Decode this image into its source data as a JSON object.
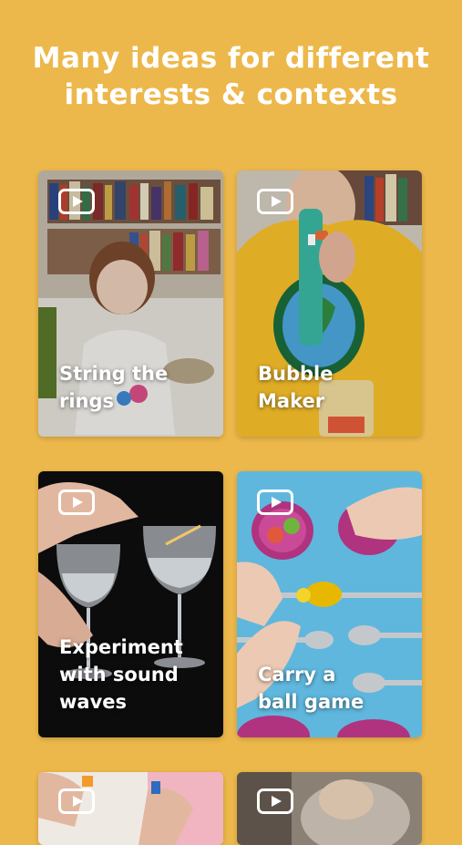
{
  "headline": "Many ideas for different\ninterests & contexts",
  "cards": [
    {
      "title": "String the\nrings",
      "icon": "play-video-icon"
    },
    {
      "title": "Bubble\nMaker",
      "icon": "play-video-icon"
    },
    {
      "title": "Experiment\nwith sound\nwaves",
      "icon": "play-video-icon"
    },
    {
      "title": "Carry a\nball game",
      "icon": "play-video-icon"
    },
    {
      "title": "",
      "icon": "play-video-icon"
    },
    {
      "title": "",
      "icon": "play-video-icon"
    }
  ],
  "colors": {
    "background": "#EDB84B",
    "text": "#FFFFFF"
  }
}
